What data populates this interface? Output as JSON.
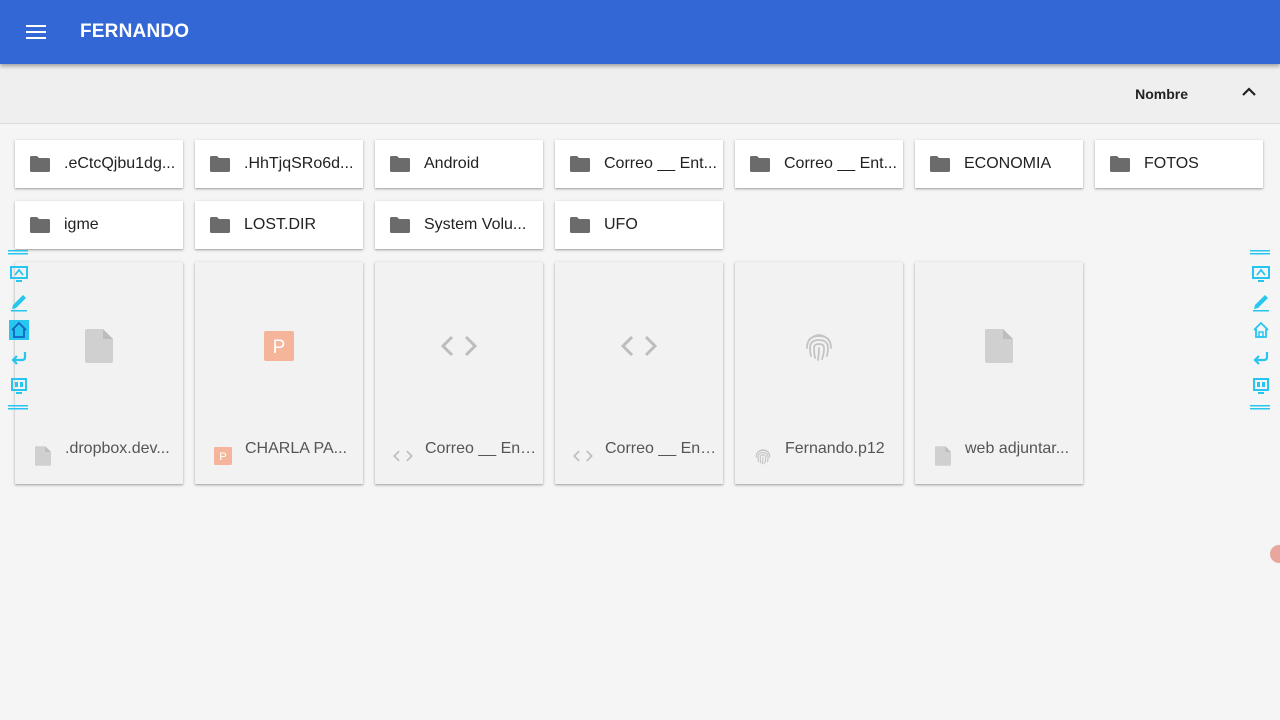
{
  "app": {
    "title": "FERNANDO",
    "menu_icon": "hamburger-menu-icon",
    "accent_color": "#3367d6"
  },
  "sort": {
    "label": "Nombre",
    "direction_icon": "chevron-up-icon"
  },
  "folders": [
    {
      "name": ".eCtcQjbu1dg..."
    },
    {
      "name": ".HhTjqSRo6d..."
    },
    {
      "name": "Android"
    },
    {
      "name": "Correo __ Ent..."
    },
    {
      "name": "Correo __ Ent..."
    },
    {
      "name": "ECONOMIA"
    },
    {
      "name": "FOTOS"
    },
    {
      "name": "igme"
    },
    {
      "name": "LOST.DIR"
    },
    {
      "name": "System Volu..."
    },
    {
      "name": "UFO"
    }
  ],
  "files": [
    {
      "name": ".dropbox.dev...",
      "icon": "generic-file-icon"
    },
    {
      "name": "CHARLA PA...",
      "icon": "powerpoint-file-icon"
    },
    {
      "name": "Correo __ Ent...",
      "icon": "code-file-icon"
    },
    {
      "name": "Correo __ Ent...",
      "icon": "code-file-icon"
    },
    {
      "name": "Fernando.p12",
      "icon": "fingerprint-certificate-icon"
    },
    {
      "name": "web adjuntar...",
      "icon": "generic-file-icon"
    }
  ],
  "overlay_toolbar": {
    "color": "#26c6f0",
    "items": [
      "screen-share-icon",
      "pencil-icon",
      "home-icon",
      "back-arrow-icon",
      "projector-icon"
    ]
  }
}
